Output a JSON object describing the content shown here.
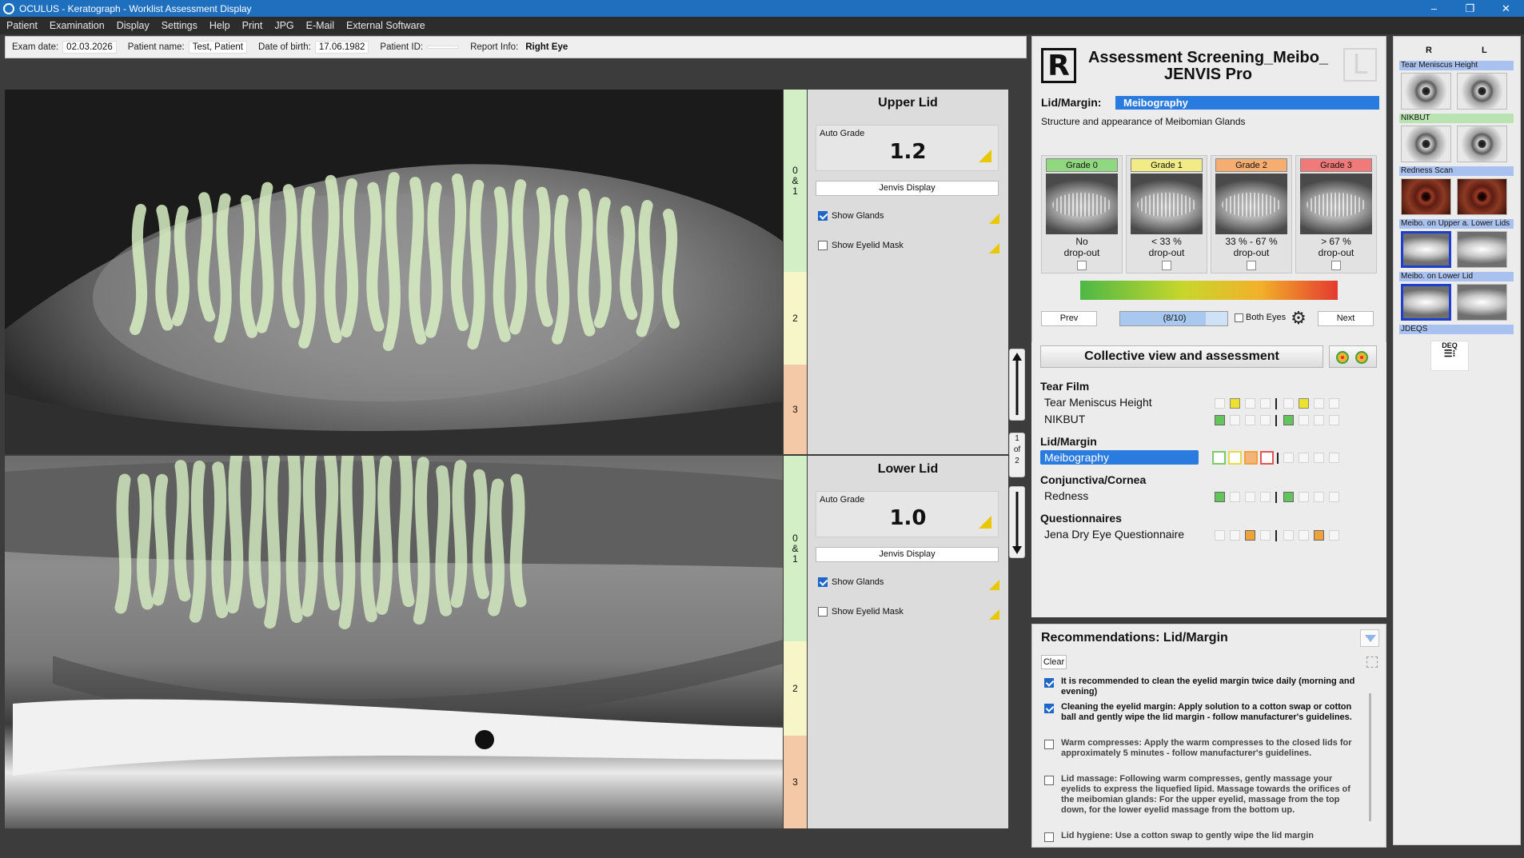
{
  "window": {
    "title": "OCULUS - Keratograph - Worklist Assessment Display",
    "controls": [
      "–",
      "❐",
      "✕"
    ]
  },
  "menu": [
    "Patient",
    "Examination",
    "Display",
    "Settings",
    "Help",
    "Print",
    "JPG",
    "E-Mail",
    "External Software"
  ],
  "info": {
    "exam_date_label": "Exam date:",
    "exam_date": "02.03.2026",
    "patient_name_label": "Patient name:",
    "patient_name": "Test, Patient",
    "dob_label": "Date of birth:",
    "dob": "17.06.1982",
    "patient_id_label": "Patient ID:",
    "patient_id": "",
    "report_info_label": "Report Info:",
    "report_info": "Right Eye"
  },
  "upper_lid": {
    "title": "Upper Lid",
    "auto_grade_label": "Auto Grade",
    "auto_grade": "1.2",
    "jenvis_button": "Jenvis Display",
    "show_glands": "Show Glands",
    "show_eyelid_mask": "Show Eyelid Mask",
    "strip": [
      "0\n&\n1",
      "2",
      "3"
    ]
  },
  "lower_lid": {
    "title": "Lower Lid",
    "auto_grade_label": "Auto Grade",
    "auto_grade": "1.0",
    "jenvis_button": "Jenvis Display",
    "show_glands": "Show Glands",
    "show_eyelid_mask": "Show Eyelid Mask",
    "strip": [
      "0\n&\n1",
      "2",
      "3"
    ]
  },
  "page_indicator": "1\nof\n2",
  "assessment": {
    "eye_badge": "R",
    "other_eye_badge": "L",
    "title": "Assessment Screening_Meibo_ JENVIS Pro",
    "category_label": "Lid/Margin:",
    "category_value": "Meibography",
    "description": "Structure and appearance of Meibomian Glands",
    "grades": [
      {
        "label": "Grade 0",
        "text": "No\ndrop-out",
        "color": "#8fd87f"
      },
      {
        "label": "Grade 1",
        "text": "< 33 %\ndrop-out",
        "color": "#f1ec86"
      },
      {
        "label": "Grade 2",
        "text": "33 % - 67 %\ndrop-out",
        "color": "#f6ae70"
      },
      {
        "label": "Grade 3",
        "text": "> 67 %\ndrop-out",
        "color": "#f07a7a"
      }
    ],
    "prev": "Prev",
    "progress": "(8/10)",
    "progress_value": 0.8,
    "both_eyes": "Both Eyes",
    "next": "Next"
  },
  "collective": {
    "title": "Collective view and assessment",
    "sections": [
      {
        "name": "Tear Film",
        "items": [
          "Tear Meniscus Height",
          "NIKBUT"
        ]
      },
      {
        "name": "Lid/Margin",
        "items": [
          "Meibography"
        ]
      },
      {
        "name": "Conjunctiva/Cornea",
        "items": [
          "Redness"
        ]
      },
      {
        "name": "Questionnaires",
        "items": [
          "Jena Dry Eye Questionnaire"
        ]
      }
    ]
  },
  "recommendations": {
    "title": "Recommendations: Lid/Margin",
    "clear": "Clear",
    "items": [
      {
        "checked": true,
        "text": "It is recommended to clean the eyelid margin twice daily (morning and evening)"
      },
      {
        "checked": true,
        "text": "Cleaning the eyelid margin: Apply solution to a cotton swap or cotton ball and gently wipe the lid margin - follow manufacturer's guidelines."
      },
      {
        "checked": false,
        "text": "Warm compresses: Apply the warm compresses to the closed lids for approximately 5 minutes - follow manufacturer's guidelines."
      },
      {
        "checked": false,
        "text": "Lid massage: Following warm compresses, gently massage your eyelids to express the liquefied lipid. Massage towards the orifices of the meibomian glands: For the upper eyelid, massage from the top down, for the lower eyelid massage from the bottom up."
      },
      {
        "checked": false,
        "text": "Lid hygiene: Use a cotton swap to gently wipe the lid margin"
      }
    ]
  },
  "thumbnails": {
    "r": "R",
    "l": "L",
    "groups": [
      "Tear Meniscus Height",
      "NIKBUT",
      "Redness Scan",
      "Meibo. on Upper a. Lower Lids",
      "Meibo. on Lower Lid",
      "JDEQS"
    ],
    "deq_label": "DEQ"
  }
}
